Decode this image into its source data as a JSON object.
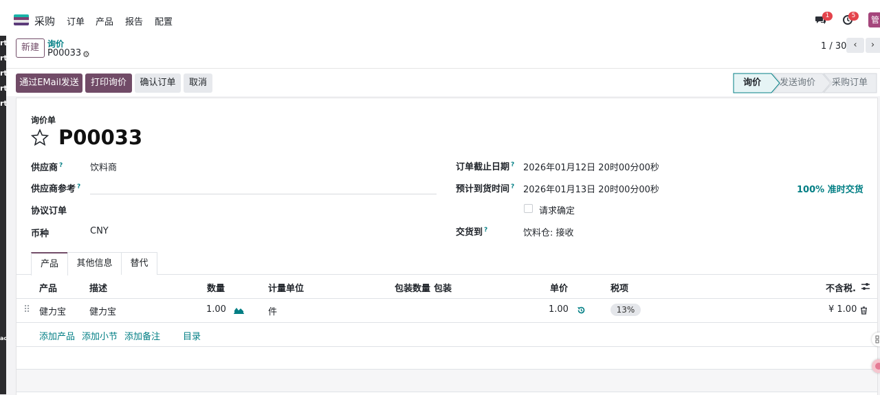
{
  "background_window": {
    "labels": [
      "rt",
      "rt",
      "rt",
      "rt",
      "rt",
      "ac"
    ]
  },
  "navbar": {
    "app_name": "采购",
    "menu": [
      "订单",
      "产品",
      "报告",
      "配置"
    ],
    "chat_badge": "1",
    "activity_badge": "5",
    "avatar_text": "管"
  },
  "control_panel": {
    "new_label": "新建",
    "breadcrumb_parent": "询价",
    "breadcrumb_current": "P00033",
    "pager": "1 / 30"
  },
  "status_bar": {
    "buttons": [
      "通过EMail发送",
      "打印询价",
      "确认订单",
      "取消"
    ],
    "stages": [
      "询价",
      "发送询价",
      "采购订单"
    ],
    "active_stage": "询价"
  },
  "form": {
    "doc_type": "询价单",
    "doc_name": "P00033",
    "vendor_label": "供应商",
    "vendor_value": "饮料商",
    "vendor_ref_label": "供应商参考",
    "vendor_ref_value": "",
    "agreement_label": "协议订单",
    "currency_label": "币种",
    "currency_value": "CNY",
    "deadline_label": "订单截止日期",
    "deadline_value": "2026年01月12日 20时00分00秒",
    "arrival_label": "预计到货时间",
    "arrival_value": "2026年01月13日 20时00分00秒",
    "on_time": "100% 准时交货",
    "ask_confirm_label": "请求确定",
    "deliver_to_label": "交货到",
    "deliver_to_value": "饮料仓: 接收"
  },
  "tabs": [
    "产品",
    "其他信息",
    "替代"
  ],
  "lines_table": {
    "headers": {
      "product": "产品",
      "description": "描述",
      "quantity": "数量",
      "uom": "计量单位",
      "pkg_qty": "包装数量",
      "packaging": "包装",
      "unit_price": "单价",
      "taxes": "税项",
      "subtotal": "不含税."
    },
    "rows": [
      {
        "product": "健力宝",
        "description": "健力宝",
        "quantity": "1.00",
        "uom": "件",
        "unit_price": "1.00",
        "tax": "13%",
        "subtotal": "¥ 1.00"
      }
    ],
    "add_links": [
      "添加产品",
      "添加小节",
      "添加备注",
      "目录"
    ]
  },
  "colors": {
    "primary": "#714b67",
    "link": "#017e84",
    "badge": "#e4434b"
  }
}
